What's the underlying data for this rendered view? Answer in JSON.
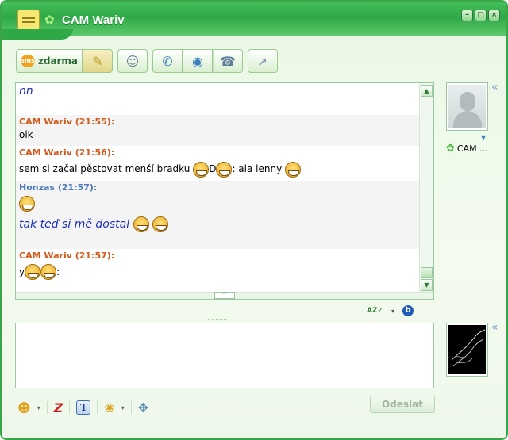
{
  "window": {
    "title": "CAM Wariv",
    "controls": [
      "minimize",
      "maximize",
      "close"
    ]
  },
  "toolbar": {
    "sms_badge": "sms",
    "sms_label": "zdarma",
    "buttons": [
      "notes-icon",
      "add-contact-icon",
      "phone-icon",
      "webcam-icon",
      "fax-icon",
      "file-transfer-icon"
    ]
  },
  "chat": {
    "messages": [
      {
        "sender": "",
        "time": "",
        "text": "nn",
        "style": "italic-blue"
      },
      {
        "sender": "CAM Wariv",
        "time": "(21:55):",
        "text": "oik"
      },
      {
        "sender": "CAM Wariv",
        "time": "(21:56):",
        "text_parts": [
          "sem si začal pěstovat menší bradku",
          "D",
          ": ala lenny"
        ]
      },
      {
        "sender": "Honzas",
        "time": "(21:57):",
        "text": "tak teď si mě dostal"
      },
      {
        "sender": "CAM Wariv",
        "time": "(21:57):",
        "text_parts": [
          "y",
          ":"
        ]
      }
    ]
  },
  "input": {
    "value": ""
  },
  "send_button": {
    "label": "Odeslat"
  },
  "contact": {
    "name": "CAM ..."
  },
  "icons": {
    "emoticon": "smiley-icon",
    "nudge": "z-icon",
    "text_format": "t-icon",
    "animation": "bee-icon",
    "games": "gamepad-icon",
    "spellcheck": "az-check-icon",
    "bold": "b-icon"
  },
  "colors": {
    "accent": "#2fa848",
    "sender_orange": "#d15a1c",
    "sender_blue": "#4d7bb7",
    "italic_text": "#1b2fbf"
  }
}
